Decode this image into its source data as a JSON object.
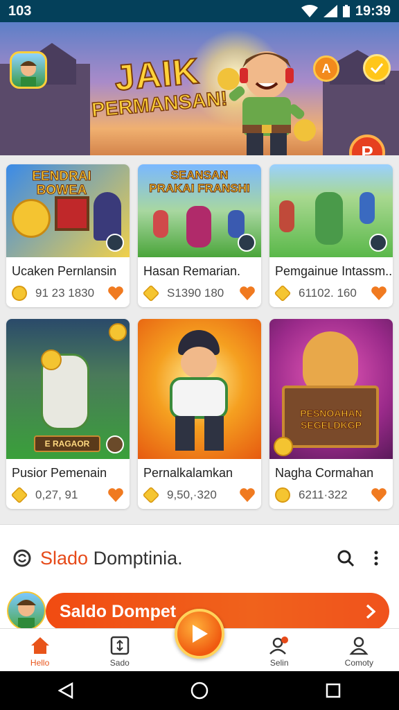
{
  "status_bar": {
    "time_left": "103",
    "clock": "19:39"
  },
  "hero": {
    "title_line1": "JAIK",
    "title_line2": "PERMANSAN!",
    "btn_a": "A",
    "btn_p": "P"
  },
  "games": [
    {
      "title": "Ucaken Pernlansin",
      "count": "91 23 1830",
      "caption": "EENDRAI BOWEA",
      "coin": "coin"
    },
    {
      "title": "Hasan Remarian.",
      "count": "S1390 180",
      "caption": "SEANSAN PRAKAI FRANSHI",
      "coin": "box"
    },
    {
      "title": "Pemgainue Intassm..",
      "count": "61102. 160",
      "caption": "",
      "coin": "gem"
    },
    {
      "title": "Pusior Pemenain",
      "count": "0,27, 91",
      "caption": "E RAGAOR",
      "coin": "box"
    },
    {
      "title": "Pernalkalamkan",
      "count": "9,50,·320",
      "caption": "",
      "coin": "gem"
    },
    {
      "title": "Nagha Cormahan",
      "count": "6211·322",
      "caption": "PESNOAHAN SEGELDKGP",
      "coin": "coin"
    }
  ],
  "section": {
    "title_accent": "Slado",
    "title_rest": " Domptinia."
  },
  "wallet": {
    "label": "Saldo Dompet"
  },
  "bottom_nav": [
    {
      "label": "Hello",
      "icon": "home-icon",
      "active": true
    },
    {
      "label": "Sado",
      "icon": "wallet-icon",
      "active": false
    },
    {
      "label": "",
      "icon": "play-icon",
      "active": false
    },
    {
      "label": "Selin",
      "icon": "friends-icon",
      "active": false
    },
    {
      "label": "Comoty",
      "icon": "profile-icon",
      "active": false
    }
  ],
  "colors": {
    "accent": "#e8541a",
    "status_bar": "#04405a",
    "wallet_bar": "#f14b12"
  }
}
